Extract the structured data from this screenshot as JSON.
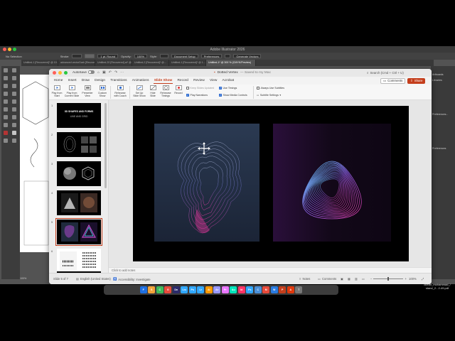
{
  "illustrator": {
    "title": "Adobe Illustrator 2026",
    "selection": "No Selection",
    "stroke_label": "Stroke:",
    "stroke_value": "1 pt. Round",
    "opacity_label": "Opacity:",
    "opacity_value": "100%",
    "style_label": "Style:",
    "document_setup": "Document Setup",
    "preferences": "Preferences",
    "generate_vectors": "Generate Vectors",
    "tabs": [
      "Untitled-1 [Recovered]* @ 10...",
      "advanced vectorDark [Recovered].ai* @...",
      "Untitled-20 [Recovered].ai* @...",
      "Untitled-2 [Recovered]* @...",
      "Untitled-1 [Recovered]* @ 1...",
      "Untitled-1* @ 300 % (CMYK/Preview)"
    ],
    "panel_items": [
      "Artboards",
      "Libraries",
      "Preferences...",
      "Preferences"
    ],
    "status_zoom": "100%"
  },
  "desktop_file": "ocean_mohammad_/ stand_2...2-49.pdf",
  "dock_icons": [
    "F",
    "S",
    "C",
    "G",
    "Dn",
    "Lrc",
    "Ps",
    "Lr",
    "Ai",
    "Ae",
    "Pr",
    "Au",
    "Id",
    "Ps",
    "C",
    "M",
    "W",
    "P",
    "A",
    "T"
  ],
  "ppt": {
    "autosave_label": "AutoSave",
    "doc_title": "Dotted Vertex",
    "saved_status": "— Saved to my Mac",
    "search_placeholder": "Search (Cmd + Ctrl + U)",
    "tabs": [
      "Home",
      "Insert",
      "Draw",
      "Design",
      "Transitions",
      "Animations",
      "Slide Show",
      "Record",
      "Review",
      "View",
      "Acrobat"
    ],
    "active_tab": "Slide Show",
    "comments_label": "Comments",
    "share_label": "Share",
    "ribbon": {
      "play_from_start": "Play from\nStart",
      "play_from_current": "Play from\nCurrent Slide",
      "presenter_view": "Presenter\nView",
      "custom_show": "Custom\nShow",
      "rehearse_coach": "Rehearse\nwith Coach",
      "set_up_slide_show": "Set Up\nSlide Show",
      "hide_slide": "Hide\nSlide",
      "rehearse_timings": "Rehearse\nTimings",
      "record": "Record",
      "keep_slides_updated": "Keep Slides Updated",
      "play_narrations": "Play Narrations",
      "use_timings": "Use Timings",
      "show_media_controls": "Show Media Controls",
      "always_use_subtitles": "Always Use Subtitles",
      "subtitle_settings": "Subtitle Settings"
    },
    "thumbnails": [
      {
        "num": "1",
        "line1": "3D SHAPES AND FORMS",
        "line2": "LINE AND GRID"
      },
      {
        "num": "2"
      },
      {
        "num": "3"
      },
      {
        "num": "4"
      },
      {
        "num": "5"
      },
      {
        "num": "6"
      },
      {
        "num": "7"
      }
    ],
    "notes_placeholder": "Click to add notes",
    "status": {
      "slide_of": "Slide 5 of 7",
      "language": "English (United States)",
      "accessibility": "Accessibility: Investigate",
      "notes": "Notes",
      "comments": "Comments",
      "zoom": "100%"
    }
  },
  "colors": {
    "ppt_accent": "#c43e1c",
    "ai_background": "#535353",
    "slide_background": "#000000",
    "shape_pink": "#e0389c",
    "shape_cyan": "#4fd6f0"
  }
}
